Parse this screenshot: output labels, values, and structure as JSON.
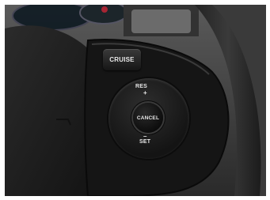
{
  "buttons": {
    "cruise": "CRUISE",
    "cancel": "CANCEL",
    "res": "RES",
    "res_symbol": "+",
    "set": "SET",
    "set_symbol": "–"
  },
  "colors": {
    "leather": "#1c1c1c",
    "panel": "#141414",
    "label_text": "#e8e8e8",
    "background": "#ffffff"
  }
}
